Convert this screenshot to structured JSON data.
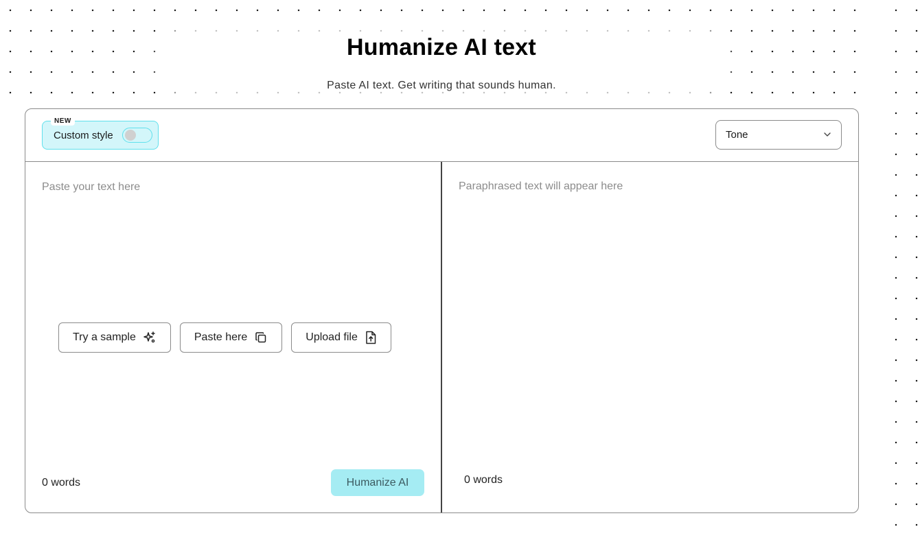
{
  "header": {
    "title": "Humanize AI text",
    "subtitle": "Paste AI text. Get writing that sounds human."
  },
  "toolbar": {
    "badge": "NEW",
    "custom_style_label": "Custom style",
    "custom_style_enabled": false,
    "tone_label": "Tone"
  },
  "input_pane": {
    "placeholder": "Paste your text here",
    "actions": [
      {
        "label": "Try a sample",
        "icon": "sparkles-icon"
      },
      {
        "label": "Paste here",
        "icon": "copy-icon"
      },
      {
        "label": "Upload file",
        "icon": "file-upload-icon"
      }
    ],
    "word_count": "0 words",
    "submit_label": "Humanize AI"
  },
  "output_pane": {
    "placeholder": "Paraphrased text will appear here",
    "word_count": "0 words"
  },
  "colors": {
    "accent": "#a5ecf3",
    "accent_border": "#5fe0ec",
    "badge_bg": "#d3f6fa"
  }
}
